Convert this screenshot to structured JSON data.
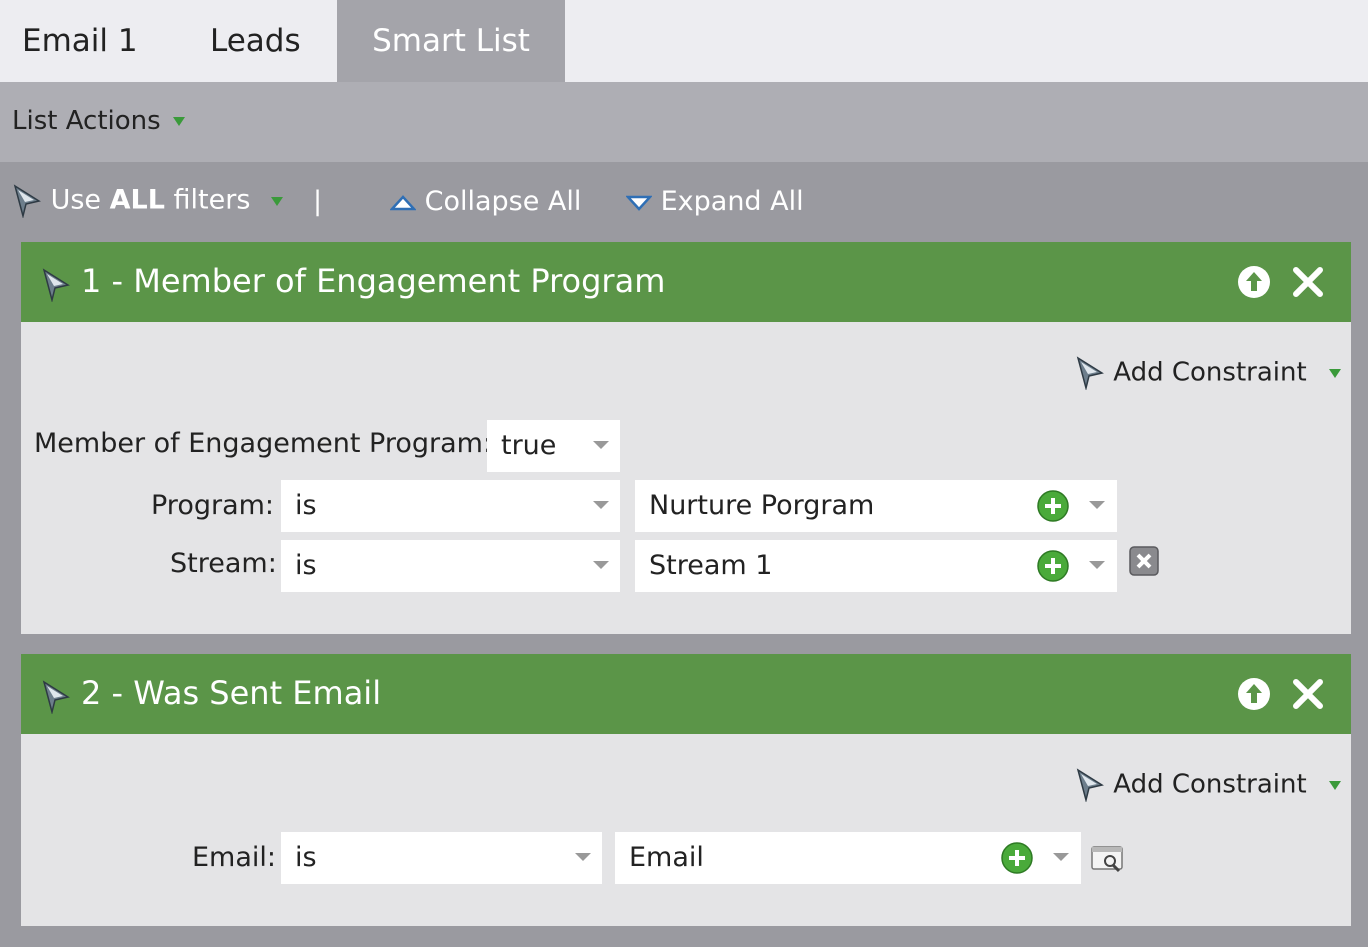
{
  "tabs": [
    {
      "label": "Email 1",
      "active": false
    },
    {
      "label": "Leads",
      "active": false
    },
    {
      "label": "Smart List",
      "active": true
    }
  ],
  "list_actions": {
    "label": "List Actions"
  },
  "toolbar": {
    "use_prefix": "Use ",
    "use_bold": "ALL",
    "use_suffix": " filters",
    "separator": "|",
    "collapse_all": "Collapse All",
    "expand_all": "Expand All"
  },
  "filters": [
    {
      "title": "1 - Member of Engagement Program",
      "add_constraint": "Add Constraint",
      "main_label": "Member of Engagement Program:",
      "main_value": "true",
      "rows": [
        {
          "label": "Program:",
          "operator": "is",
          "value": "Nurture Porgram"
        },
        {
          "label": "Stream:",
          "operator": "is",
          "value": "Stream 1"
        }
      ]
    },
    {
      "title": "2 - Was Sent Email",
      "add_constraint": "Add Constraint",
      "rows": [
        {
          "label": "Email:",
          "operator": "is",
          "value": "Email"
        }
      ]
    }
  ],
  "colors": {
    "header_green": "#5b9548",
    "background_gray": "#9a9aa0",
    "panel_gray": "#e4e4e6",
    "accent_green": "#3a9a3a",
    "collapse_blue": "#2f6fb5"
  }
}
